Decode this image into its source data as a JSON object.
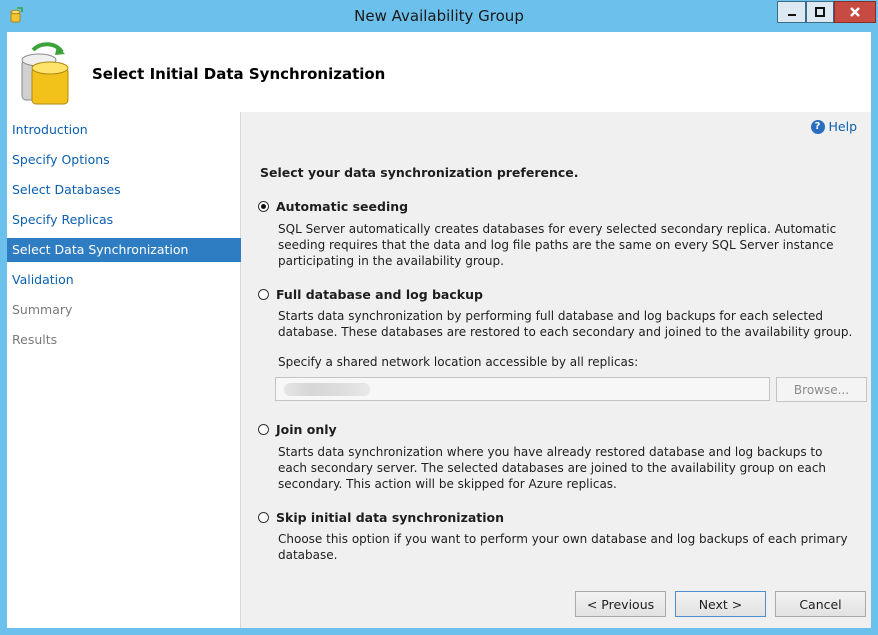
{
  "window": {
    "title": "New Availability Group"
  },
  "header": {
    "title": "Select Initial Data Synchronization"
  },
  "sidebar": {
    "items": [
      {
        "label": "Introduction",
        "state": "link"
      },
      {
        "label": "Specify Options",
        "state": "link"
      },
      {
        "label": "Select Databases",
        "state": "link"
      },
      {
        "label": "Specify Replicas",
        "state": "link"
      },
      {
        "label": "Select Data Synchronization",
        "state": "active"
      },
      {
        "label": "Validation",
        "state": "link"
      },
      {
        "label": "Summary",
        "state": "disabled"
      },
      {
        "label": "Results",
        "state": "disabled"
      }
    ]
  },
  "main": {
    "help_label": "Help",
    "prompt": "Select your data synchronization preference.",
    "options": [
      {
        "label": "Automatic seeding",
        "selected": true,
        "description": "SQL Server automatically creates databases for every selected secondary replica. Automatic seeding requires that the data and log file paths are the same on every SQL Server instance participating in the availability group."
      },
      {
        "label": "Full database and log backup",
        "selected": false,
        "description": "Starts data synchronization by performing full database and log backups for each selected database. These databases are restored to each secondary and joined to the availability group."
      },
      {
        "label": "Join only",
        "selected": false,
        "description": "Starts data synchronization where you have already restored database and log backups to each secondary server. The selected databases are joined to the availability group on each secondary. This action will be skipped for Azure replicas."
      },
      {
        "label": "Skip initial data synchronization",
        "selected": false,
        "description": "Choose this option if you want to perform your own database and log backups of each primary database."
      }
    ],
    "share": {
      "label": "Specify a shared network location accessible by all replicas:",
      "value": "",
      "browse_label": "Browse..."
    }
  },
  "footer": {
    "previous_label": "< Previous",
    "next_label": "Next >",
    "cancel_label": "Cancel"
  },
  "colors": {
    "title_bar": "#6cc0ec",
    "active_nav": "#2e7cc2",
    "link": "#0b5fb0",
    "close_button": "#c74a43"
  },
  "icons": {
    "app": "availability-group-icon",
    "header": "database-sync-icon",
    "help": "help-icon"
  }
}
